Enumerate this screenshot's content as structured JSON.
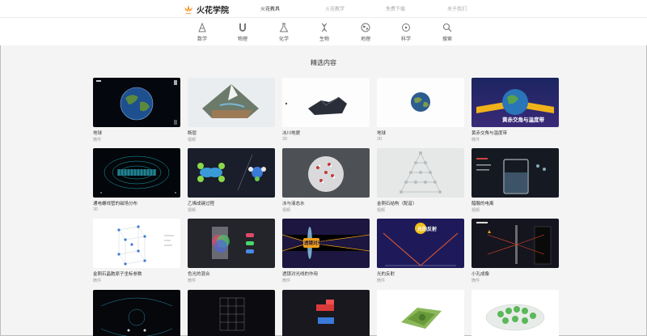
{
  "header": {
    "logo_text": "火花学院",
    "nav": [
      "火花教具",
      "火花教学",
      "免费下载",
      "关于我们"
    ],
    "active_index": 0
  },
  "categories": [
    {
      "label": "数学",
      "icon": "math-icon"
    },
    {
      "label": "物理",
      "icon": "magnet-icon"
    },
    {
      "label": "化学",
      "icon": "flask-icon"
    },
    {
      "label": "生物",
      "icon": "dna-icon"
    },
    {
      "label": "地理",
      "icon": "globe-icon"
    },
    {
      "label": "科学",
      "icon": "atom-icon"
    },
    {
      "label": "搜索",
      "icon": "search-icon"
    }
  ],
  "section_title": "精选内容",
  "cards": [
    {
      "title": "地球",
      "type": "微件"
    },
    {
      "title": "断层",
      "type": "视频"
    },
    {
      "title": "冰川地貌",
      "type": "3D"
    },
    {
      "title": "地球",
      "type": "3D"
    },
    {
      "title": "黄赤交角与温度带",
      "type": "微件",
      "overlay": "黄赤交角与温度带"
    },
    {
      "title": "通电螺线管的磁场分布",
      "type": "3D"
    },
    {
      "title": "乙烯成键过程",
      "type": "视频"
    },
    {
      "title": "冰与液态水",
      "type": "视频"
    },
    {
      "title": "金刚石结构（配音）",
      "type": "视频"
    },
    {
      "title": "醋酸的电离",
      "type": "视频"
    },
    {
      "title": "金刚石晶胞原子坐标参数",
      "type": "微件"
    },
    {
      "title": "色光的混合",
      "type": "微件"
    },
    {
      "title": "透镜对光线的作用",
      "type": "微件",
      "overlay": "透镜对光线的作用"
    },
    {
      "title": "光的反射",
      "type": "微件",
      "overlay": "光的反射"
    },
    {
      "title": "小孔成像",
      "type": "微件"
    },
    {
      "title": "",
      "type": ""
    },
    {
      "title": "",
      "type": ""
    },
    {
      "title": "",
      "type": ""
    },
    {
      "title": "",
      "type": ""
    },
    {
      "title": "",
      "type": ""
    }
  ]
}
